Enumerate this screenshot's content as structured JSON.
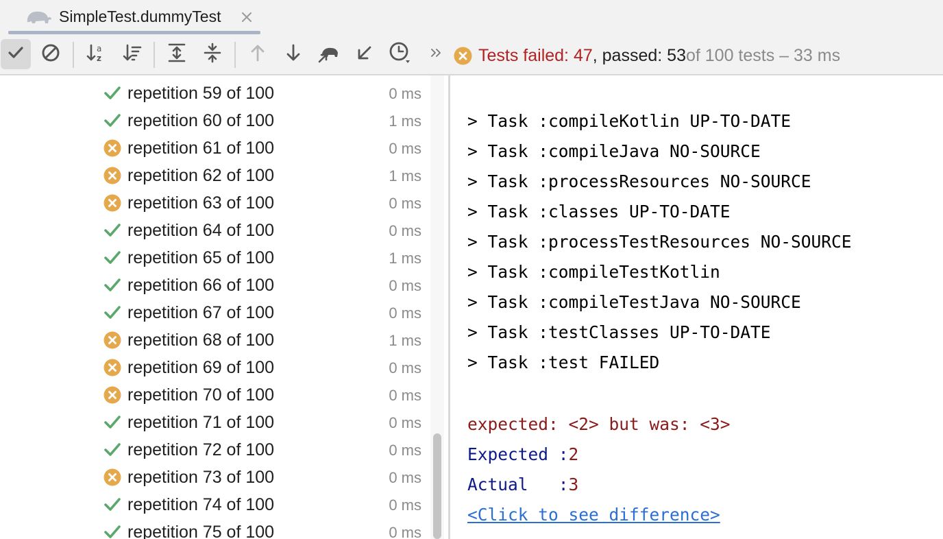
{
  "tab": {
    "title": "SimpleTest.dummyTest",
    "icon": "gradle-elephant-icon"
  },
  "toolbar": {
    "buttons": [
      {
        "name": "show-passed-button",
        "icon": "check-icon",
        "active": true
      },
      {
        "name": "show-ignored-button",
        "icon": "ban-icon"
      },
      {
        "name": "sort-alphabetically-button",
        "icon": "sort-alpha-icon"
      },
      {
        "name": "sort-by-duration-button",
        "icon": "sort-duration-icon"
      },
      {
        "name": "expand-all-button",
        "icon": "expand-all-icon"
      },
      {
        "name": "collapse-all-button",
        "icon": "collapse-all-icon"
      },
      {
        "name": "previous-failed-button",
        "icon": "arrow-up-icon"
      },
      {
        "name": "next-failed-button",
        "icon": "arrow-down-icon"
      },
      {
        "name": "gradle-import-button",
        "icon": "elephant-arrow-icon"
      },
      {
        "name": "export-results-button",
        "icon": "arrow-down-left-icon"
      },
      {
        "name": "test-history-button",
        "icon": "clock-icon"
      },
      {
        "name": "more-button",
        "icon": "chevron-double-right-icon"
      }
    ],
    "status": {
      "failed_label": "Tests failed: 47",
      "comma_passed": ", passed: 53",
      "suffix": " of 100 tests – 33 ms"
    }
  },
  "tests": [
    {
      "name": "repetition 59 of 100",
      "time": "0 ms",
      "status": "passed"
    },
    {
      "name": "repetition 60 of 100",
      "time": "1 ms",
      "status": "passed"
    },
    {
      "name": "repetition 61 of 100",
      "time": "0 ms",
      "status": "failed"
    },
    {
      "name": "repetition 62 of 100",
      "time": "1 ms",
      "status": "failed"
    },
    {
      "name": "repetition 63 of 100",
      "time": "0 ms",
      "status": "failed"
    },
    {
      "name": "repetition 64 of 100",
      "time": "0 ms",
      "status": "passed"
    },
    {
      "name": "repetition 65 of 100",
      "time": "1 ms",
      "status": "passed"
    },
    {
      "name": "repetition 66 of 100",
      "time": "0 ms",
      "status": "passed"
    },
    {
      "name": "repetition 67 of 100",
      "time": "0 ms",
      "status": "passed"
    },
    {
      "name": "repetition 68 of 100",
      "time": "1 ms",
      "status": "failed"
    },
    {
      "name": "repetition 69 of 100",
      "time": "0 ms",
      "status": "failed"
    },
    {
      "name": "repetition 70 of 100",
      "time": "0 ms",
      "status": "failed"
    },
    {
      "name": "repetition 71 of 100",
      "time": "0 ms",
      "status": "passed"
    },
    {
      "name": "repetition 72 of 100",
      "time": "0 ms",
      "status": "passed"
    },
    {
      "name": "repetition 73 of 100",
      "time": "0 ms",
      "status": "failed"
    },
    {
      "name": "repetition 74 of 100",
      "time": "0 ms",
      "status": "passed"
    },
    {
      "name": "repetition 75 of 100",
      "time": "0 ms",
      "status": "passed"
    }
  ],
  "console": {
    "tasks": [
      "> Task :compileKotlin UP-TO-DATE",
      "> Task :compileJava NO-SOURCE",
      "> Task :processResources NO-SOURCE",
      "> Task :classes UP-TO-DATE",
      "> Task :processTestResources NO-SOURCE",
      "> Task :compileTestKotlin",
      "> Task :compileTestJava NO-SOURCE",
      "> Task :testClasses UP-TO-DATE",
      "> Task :test FAILED"
    ],
    "error_message": "expected: <2> but was: <3>",
    "expected_label": "Expected :",
    "expected_value": "2",
    "actual_label": "Actual   :",
    "actual_value": "3",
    "diff_link": "<Click to see difference>"
  },
  "colors": {
    "passed": "#59a869",
    "failed": "#e5a94d",
    "fail_text": "#b22222",
    "link": "#2a6fd6"
  }
}
